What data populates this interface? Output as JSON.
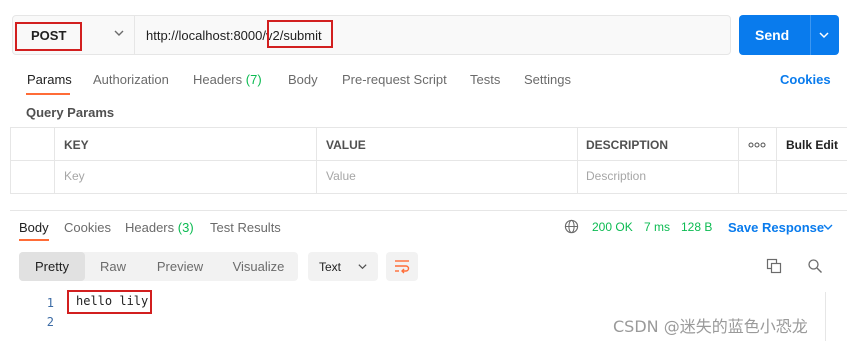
{
  "request": {
    "method": "POST",
    "url": "http://localhost:8000/v2/submit",
    "send_label": "Send"
  },
  "request_tabs": [
    {
      "label": "Params"
    },
    {
      "label": "Authorization"
    },
    {
      "label": "Headers",
      "count": "(7)"
    },
    {
      "label": "Body"
    },
    {
      "label": "Pre-request Script"
    },
    {
      "label": "Tests"
    },
    {
      "label": "Settings"
    }
  ],
  "cookies_link": "Cookies",
  "query_params": {
    "title": "Query Params",
    "columns": [
      "KEY",
      "VALUE",
      "DESCRIPTION"
    ],
    "bulk_edit": "Bulk Edit",
    "placeholders": [
      "Key",
      "Value",
      "Description"
    ]
  },
  "response_tabs": [
    {
      "label": "Body"
    },
    {
      "label": "Cookies"
    },
    {
      "label": "Headers",
      "count": "(3)"
    },
    {
      "label": "Test Results"
    }
  ],
  "response_status": {
    "status": "200 OK",
    "time": "7 ms",
    "size": "128 B",
    "save_label": "Save Response"
  },
  "format_modes": [
    "Pretty",
    "Raw",
    "Preview",
    "Visualize"
  ],
  "format_type": "Text",
  "response_body": {
    "line_numbers": [
      "1",
      "2"
    ],
    "line1": "hello lily"
  },
  "watermark": "CSDN @迷失的蓝色小恐龙",
  "colors": {
    "send": "#097bed",
    "accent": "#ff6c37",
    "success": "#0cbb52",
    "highlight": "#d21f1f"
  }
}
